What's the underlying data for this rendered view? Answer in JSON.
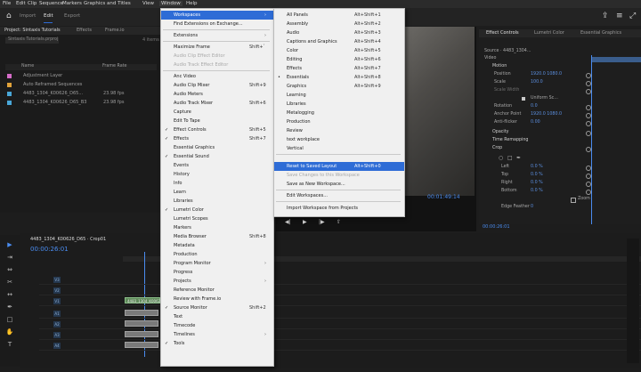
{
  "menubar": {
    "items": [
      "File",
      "Edit",
      "Clip",
      "Sequence",
      "Markers",
      "Graphics and Titles",
      "View",
      "Window",
      "Help"
    ]
  },
  "workspace_tabs": [
    "Import",
    "Edit",
    "Export"
  ],
  "project_panel": {
    "tabs": [
      "Project: Sintaxis Tutorials",
      "Effects",
      "Frame.io"
    ],
    "project_file": "Sintaxis Tutorials.prproj",
    "columns": {
      "name": "Name",
      "frame_rate": "Frame Rate"
    },
    "items": [
      {
        "name": "Adjustment Layer",
        "frame_rate": "",
        "color": "#d56cc8"
      },
      {
        "name": "Auto Reframed Sequences",
        "frame_rate": "",
        "color": "#e0a23a"
      },
      {
        "name": "4483_1304_K00626_D65...",
        "frame_rate": "23.98 fps",
        "color": "#49a7d8"
      },
      {
        "name": "4483_1304_K00626_D65_B3",
        "frame_rate": "23.98 fps",
        "color": "#49a7d8"
      }
    ]
  },
  "window_menu": {
    "items": [
      {
        "label": "Workspaces",
        "shortcut": "",
        "submenu": true,
        "highlight": true
      },
      {
        "label": "Find Extensions on Exchange...",
        "shortcut": ""
      },
      {
        "sep": true
      },
      {
        "label": "Extensions",
        "shortcut": "",
        "submenu": true
      },
      {
        "sep": true
      },
      {
        "label": "Maximize Frame",
        "shortcut": "Shift+`"
      },
      {
        "label": "Audio Clip Effect Editor",
        "shortcut": "",
        "disabled": true
      },
      {
        "label": "Audio Track Effect Editor",
        "shortcut": "",
        "disabled": true
      },
      {
        "sep": true
      },
      {
        "label": "Anc Video",
        "shortcut": ""
      },
      {
        "label": "Audio Clip Mixer",
        "shortcut": "Shift+9"
      },
      {
        "label": "Audio Meters",
        "shortcut": ""
      },
      {
        "label": "Audio Track Mixer",
        "shortcut": "Shift+6"
      },
      {
        "label": "Capture",
        "shortcut": ""
      },
      {
        "label": "Edit To Tape",
        "shortcut": ""
      },
      {
        "label": "Effect Controls",
        "shortcut": "Shift+5",
        "checked": true
      },
      {
        "label": "Effects",
        "shortcut": "Shift+7",
        "checked": true
      },
      {
        "label": "Essential Graphics",
        "shortcut": ""
      },
      {
        "label": "Essential Sound",
        "shortcut": "",
        "checked": true
      },
      {
        "label": "Events",
        "shortcut": ""
      },
      {
        "label": "History",
        "shortcut": ""
      },
      {
        "label": "Info",
        "shortcut": ""
      },
      {
        "label": "Learn",
        "shortcut": ""
      },
      {
        "label": "Libraries",
        "shortcut": ""
      },
      {
        "label": "Lumetri Color",
        "shortcut": "",
        "checked": true
      },
      {
        "label": "Lumetri Scopes",
        "shortcut": ""
      },
      {
        "label": "Markers",
        "shortcut": ""
      },
      {
        "label": "Media Browser",
        "shortcut": "Shift+8"
      },
      {
        "label": "Metadata",
        "shortcut": ""
      },
      {
        "label": "Production",
        "shortcut": ""
      },
      {
        "label": "Program Monitor",
        "shortcut": "",
        "submenu": true
      },
      {
        "label": "Progress",
        "shortcut": ""
      },
      {
        "label": "Projects",
        "shortcut": "",
        "submenu": true
      },
      {
        "label": "Reference Monitor",
        "shortcut": ""
      },
      {
        "label": "Review with Frame.io",
        "shortcut": ""
      },
      {
        "label": "Source Monitor",
        "shortcut": "Shift+2",
        "checked": true
      },
      {
        "label": "Text",
        "shortcut": ""
      },
      {
        "label": "Timecode",
        "shortcut": ""
      },
      {
        "label": "Timelines",
        "shortcut": "",
        "submenu": true
      },
      {
        "label": "Tools",
        "shortcut": "",
        "checked": true
      }
    ]
  },
  "workspaces_submenu": {
    "items": [
      {
        "label": "All Panels",
        "shortcut": "Alt+Shift+1"
      },
      {
        "label": "Assembly",
        "shortcut": "Alt+Shift+2"
      },
      {
        "label": "Audio",
        "shortcut": "Alt+Shift+3"
      },
      {
        "label": "Captions and Graphics",
        "shortcut": "Alt+Shift+4"
      },
      {
        "label": "Color",
        "shortcut": "Alt+Shift+5"
      },
      {
        "label": "Editing",
        "shortcut": "Alt+Shift+6"
      },
      {
        "label": "Effects",
        "shortcut": "Alt+Shift+7"
      },
      {
        "label": "Essentials",
        "shortcut": "Alt+Shift+8",
        "dot": true
      },
      {
        "label": "Graphics",
        "shortcut": "Alt+Shift+9"
      },
      {
        "label": "Learning",
        "shortcut": ""
      },
      {
        "label": "Libraries",
        "shortcut": ""
      },
      {
        "label": "Metalogging",
        "shortcut": ""
      },
      {
        "label": "Production",
        "shortcut": ""
      },
      {
        "label": "Review",
        "shortcut": ""
      },
      {
        "label": "text workplace",
        "shortcut": ""
      },
      {
        "label": "Vertical",
        "shortcut": ""
      },
      {
        "sep": true
      },
      {
        "label": "Reset to Saved Layout",
        "shortcut": "Alt+Shift+0",
        "highlight": true
      },
      {
        "label": "Save Changes to this Workspace",
        "shortcut": "",
        "disabled": true
      },
      {
        "label": "Save as New Workspace...",
        "shortcut": ""
      },
      {
        "sep": true
      },
      {
        "label": "Edit Workspaces...",
        "shortcut": ""
      },
      {
        "sep": true
      },
      {
        "label": "Import Workspace from Projects",
        "shortcut": ""
      }
    ]
  },
  "program_monitor": {
    "timecode": "00:01:49:14"
  },
  "effect_controls": {
    "tabs": [
      "Effect Controls",
      "Lumetri Color",
      "Essential Graphics"
    ],
    "source_label": "Source · 4483_1304...",
    "video_label": "Video",
    "rows": [
      {
        "label": "Motion",
        "value": ""
      },
      {
        "label": "Position",
        "value": "1920.0  1080.0"
      },
      {
        "label": "Scale",
        "value": "100.0"
      },
      {
        "label": "Scale Width",
        "value": ""
      },
      {
        "label": "",
        "value": "Uniform Sc..."
      },
      {
        "label": "Rotation",
        "value": "0.0"
      },
      {
        "label": "Anchor Point",
        "value": "1920.0  1080.0"
      },
      {
        "label": "Anti-flicker",
        "value": "0.00"
      },
      {
        "label": "Opacity",
        "value": ""
      },
      {
        "label": "Time Remapping",
        "value": ""
      },
      {
        "label": "Crop",
        "value": ""
      },
      {
        "label": "Left",
        "value": "0.0 %"
      },
      {
        "label": "Top",
        "value": "0.0 %"
      },
      {
        "label": "Right",
        "value": "0.0 %"
      },
      {
        "label": "Bottom",
        "value": "0.0 %"
      },
      {
        "label": "",
        "value": "Zoom"
      },
      {
        "label": "Edge Feather",
        "value": "0"
      }
    ],
    "timecode": "00:00:26:01"
  },
  "timeline": {
    "sequence_tab": "4483_1304_K00626_D65 · Crop01",
    "timecode": "00:00:26:01",
    "video_tracks": [
      "V3",
      "V2",
      "V1"
    ],
    "audio_tracks": [
      "A1",
      "A2",
      "A3",
      "A4"
    ],
    "clip_labels": [
      "4483_1304_K00626...",
      "fx"
    ],
    "audio_clip_label": ""
  },
  "colors": {
    "accent": "#2e6cd6",
    "timecode": "#4a8cf0",
    "clip_video": "#5f8a5a"
  }
}
